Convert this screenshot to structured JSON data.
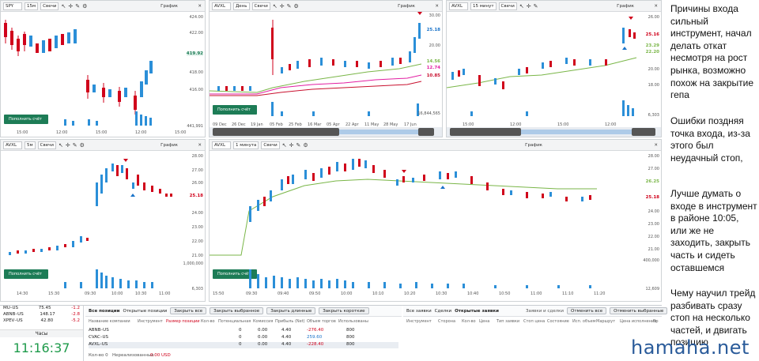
{
  "panels": {
    "p1": {
      "symbol": "SPY",
      "interval": "15м",
      "type": "Свечи",
      "graph": "График",
      "fill": "Пополнить счёт",
      "prices": [
        "424.00",
        "422.00",
        "420.00",
        "418.00",
        "416.00"
      ],
      "current": "419.92",
      "vol": "441,991",
      "times": [
        "15:00",
        "12:00",
        "15:00",
        "12:00",
        "15:00"
      ]
    },
    "p2": {
      "symbol": "AVXL",
      "interval": "День",
      "type": "Свечи",
      "graph": "График",
      "fill": "Пополнить счёт",
      "prices": [
        "30.00",
        "25.00",
        "20.00",
        "15.00",
        "10.00"
      ],
      "marks": [
        "25.18",
        "14.56",
        "12.74",
        "10.85"
      ],
      "vol": "16,844,565",
      "times": [
        "09 Dec",
        "26 Dec",
        "19 Jan",
        "05 Feb",
        "25 Feb",
        "16 Mar",
        "05 Apr",
        "22 Apr",
        "11 May",
        "28 May",
        "17 Jun"
      ]
    },
    "p3": {
      "symbol": "AVXL",
      "interval": "15 минут",
      "type": "Свечи",
      "graph": "График",
      "fill": "",
      "prices": [
        "26.00",
        "24.00",
        "22.00",
        "20.00",
        "18.00",
        "16.00"
      ],
      "marks": [
        "25.16",
        "23.29",
        "22.20"
      ],
      "vol": "6,303",
      "times": [
        "15:00",
        "12:00",
        "15:00",
        "12:00"
      ]
    },
    "p4": {
      "symbol": "AVXL",
      "interval": "5м",
      "type": "Свечи",
      "graph": "График",
      "fill": "Пополнить счёт",
      "prices": [
        "28.00",
        "27.00",
        "26.00",
        "25.00",
        "24.00",
        "23.00",
        "22.00",
        "21.00"
      ],
      "current": "25.18",
      "vol": "1,000,000",
      "vol2": "6,303",
      "times": [
        "14:30",
        "15:30",
        "09:30",
        "10:00",
        "10:30",
        "11:00"
      ]
    },
    "p5": {
      "symbol": "AVXL",
      "interval": "1 минута",
      "type": "Свечи",
      "graph": "График",
      "fill": "Пополнить счёт",
      "prices": [
        "28.00",
        "27.00",
        "26.00",
        "25.00",
        "24.00",
        "23.00",
        "22.00",
        "21.00",
        "20.00"
      ],
      "marks": [
        "26.25",
        "25.18"
      ],
      "vol": "400,000",
      "vol2": "12,609",
      "times": [
        "15:50",
        "09:30",
        "09:40",
        "09:50",
        "10:00",
        "10:10",
        "10:20",
        "10:30",
        "10:40",
        "10:50",
        "11:00",
        "11:10",
        "11:20"
      ]
    }
  },
  "notes": {
    "n1": "Причины входа сильный инструмент, начал делать откат несмотря на рост рынка, возможно похож на закрытие гепа",
    "n2": "Ошибки поздняя точка входа, из-за этого был неудачный стоп,",
    "n3": "Лучше думать о входе в инструмент в районе 10:05, или же не заходить, закрыть часть и сидеть оставшемся",
    "n4": "Чему научил трейд разбивать сразу стоп на несколько частей, и двигать позицию"
  },
  "watch": [
    {
      "sym": "MU–US",
      "price": "75.45",
      "chg": "-1.2"
    },
    {
      "sym": "ABNB–US",
      "price": "148.17",
      "chg": "-2.8"
    },
    {
      "sym": "XPEV–US",
      "price": "42.80",
      "chg": "-5.2"
    }
  ],
  "clock": {
    "label": "Часы",
    "time": "11:16:37"
  },
  "positions": {
    "tabs": [
      "Все позиции",
      "Открытые позиции"
    ],
    "title": "Позиции",
    "buttons": [
      "Закрыть все",
      "Закрыть выбранное",
      "Закрыть длинные",
      "Закрыть короткие"
    ],
    "headers": [
      "Название компании",
      "Инструмент",
      "Размер позиции",
      "Кол-во",
      "Потенциальная",
      "Комиссия",
      "Прибыль (Net)",
      "Объем торгов",
      "Использованы"
    ],
    "rows": [
      {
        "name": "ABNB–US",
        "qty": "0",
        "pot": "0.00",
        "com": "4.40",
        "pnl": "-276.40",
        "vol": "800",
        "neg": true
      },
      {
        "name": "CVAC–US",
        "qty": "0",
        "pot": "0.00",
        "com": "4.40",
        "pnl": "259.60",
        "vol": "800",
        "neg": false
      },
      {
        "name": "AVXL–US",
        "qty": "0",
        "pot": "0.00",
        "com": "4.40",
        "pnl": "-228.40",
        "vol": "800",
        "neg": true
      }
    ],
    "footer_qty": "Кол-во 0",
    "footer_unreal": "Нереализованные",
    "footer_val": "0.00 USD"
  },
  "orders": {
    "tabs": [
      "Все заявки",
      "Сделки",
      "Открытые заявки"
    ],
    "title": "Заявки и сделки",
    "buttons": [
      "Отменить все",
      "Отменить выбранные"
    ],
    "headers": [
      "Инструмент",
      "Сторона",
      "Кол-во",
      "Цена",
      "Тип заявки",
      "Стоп цена",
      "Состояние",
      "Исп. объем",
      "Маршрут",
      "Цена исполнения",
      "Вр"
    ]
  },
  "brand": "hamaha.net"
}
